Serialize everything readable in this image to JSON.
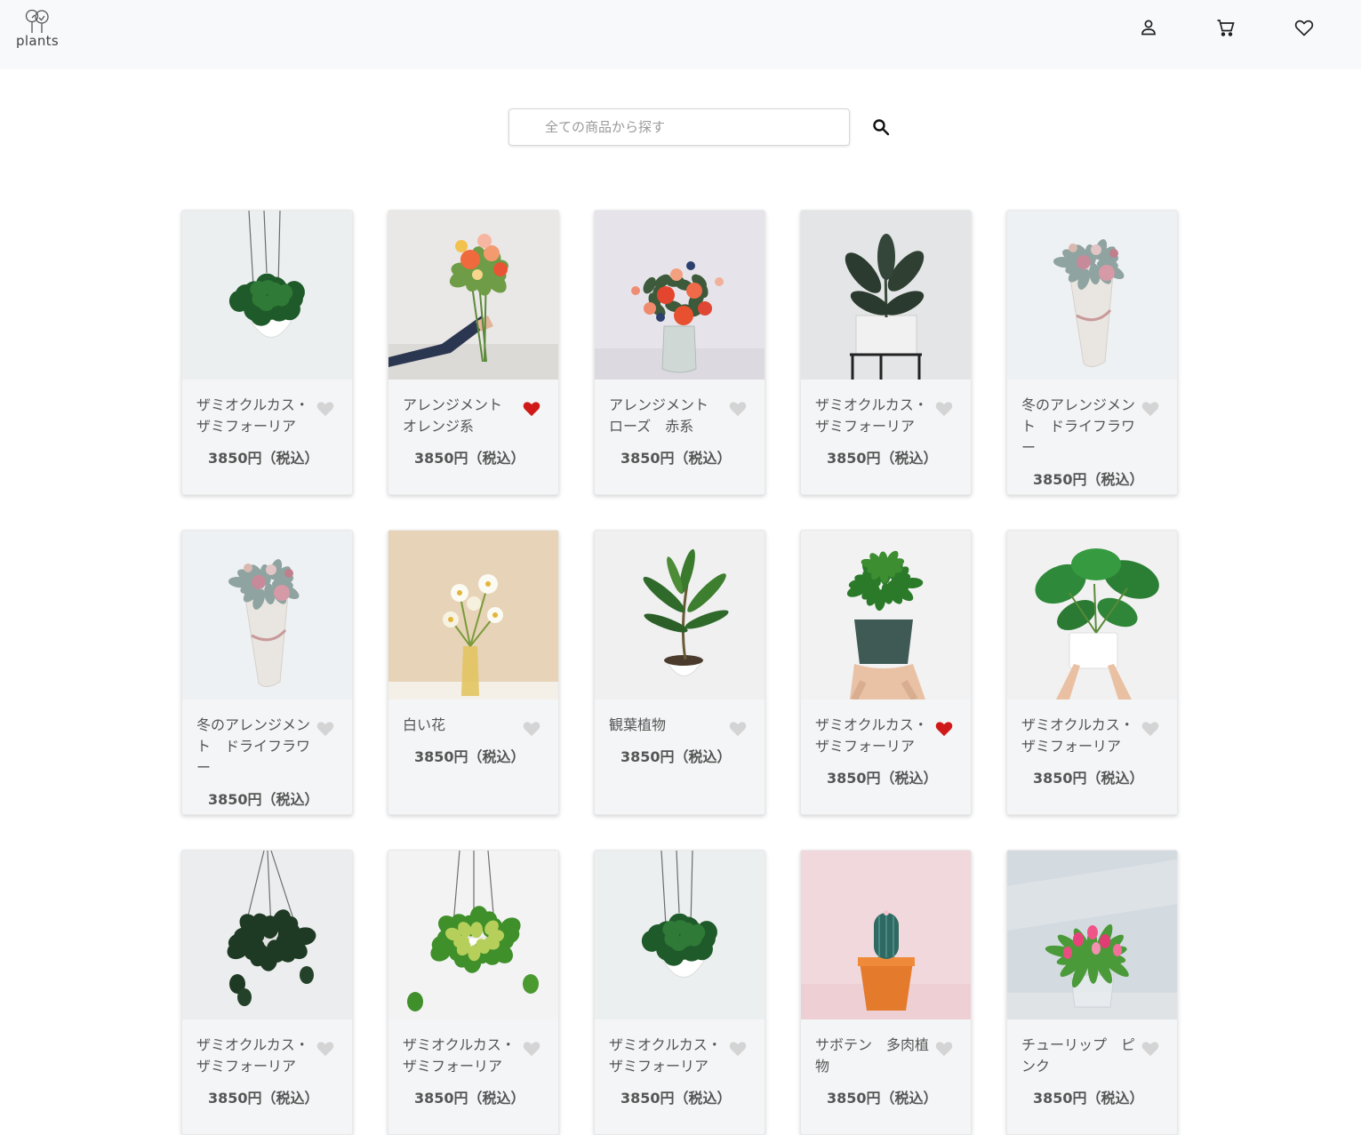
{
  "header": {
    "logo_text": "plants",
    "icons": [
      "account-icon",
      "cart-icon",
      "wishlist-heart-icon"
    ]
  },
  "search": {
    "placeholder": "全ての商品から探す",
    "value": ""
  },
  "colors": {
    "header_bg": "#f8f9fa",
    "card_bg": "#f4f5f6",
    "heart_active": "#d01a1a",
    "heart_inactive": "#d4d4d4"
  },
  "products": [
    {
      "name": "ザミオクルカス・ザミフォーリア",
      "price": "3850円（税込）",
      "favorite": false,
      "image": "hanging-plant-pilea"
    },
    {
      "name": "アレンジメント　オレンジ系",
      "price": "3850円（税込）",
      "favorite": true,
      "image": "hand-holding-bouquet"
    },
    {
      "name": "アレンジメント　ローズ　赤系",
      "price": "3850円（税込）",
      "favorite": false,
      "image": "red-rose-vase"
    },
    {
      "name": "ザミオクルカス・ザミフォーリア",
      "price": "3850円（税込）",
      "favorite": false,
      "image": "rubber-plant-stand"
    },
    {
      "name": "冬のアレンジメント　ドライフラワー",
      "price": "3850円（税込）",
      "favorite": false,
      "image": "dried-flower-bouquet"
    },
    {
      "name": "冬のアレンジメント　ドライフラワー",
      "price": "3850円（税込）",
      "favorite": false,
      "image": "dried-flower-bouquet"
    },
    {
      "name": "白い花",
      "price": "3850円（税込）",
      "favorite": false,
      "image": "white-flowers-vase"
    },
    {
      "name": "観葉植物",
      "price": "3850円（税込）",
      "favorite": false,
      "image": "foliage-plant-pot"
    },
    {
      "name": "ザミオクルカス・ザミフォーリア",
      "price": "3850円（税込）",
      "favorite": true,
      "image": "zz-plant-hand"
    },
    {
      "name": "ザミオクルカス・ザミフォーリア",
      "price": "3850円（税込）",
      "favorite": false,
      "image": "monstera-hands"
    },
    {
      "name": "ザミオクルカス・ザミフォーリア",
      "price": "3850円（税込）",
      "favorite": false,
      "image": "hanging-dark-pothos"
    },
    {
      "name": "ザミオクルカス・ザミフォーリア",
      "price": "3850円（税込）",
      "favorite": false,
      "image": "hanging-pothos-white"
    },
    {
      "name": "ザミオクルカス・ザミフォーリア",
      "price": "3850円（税込）",
      "favorite": false,
      "image": "hanging-plant-pilea"
    },
    {
      "name": "サボテン　多肉植物",
      "price": "3850円（税込）",
      "favorite": false,
      "image": "cactus-pink"
    },
    {
      "name": "チューリップ　ピンク",
      "price": "3850円（税込）",
      "favorite": false,
      "image": "pink-tulips-vase"
    }
  ]
}
